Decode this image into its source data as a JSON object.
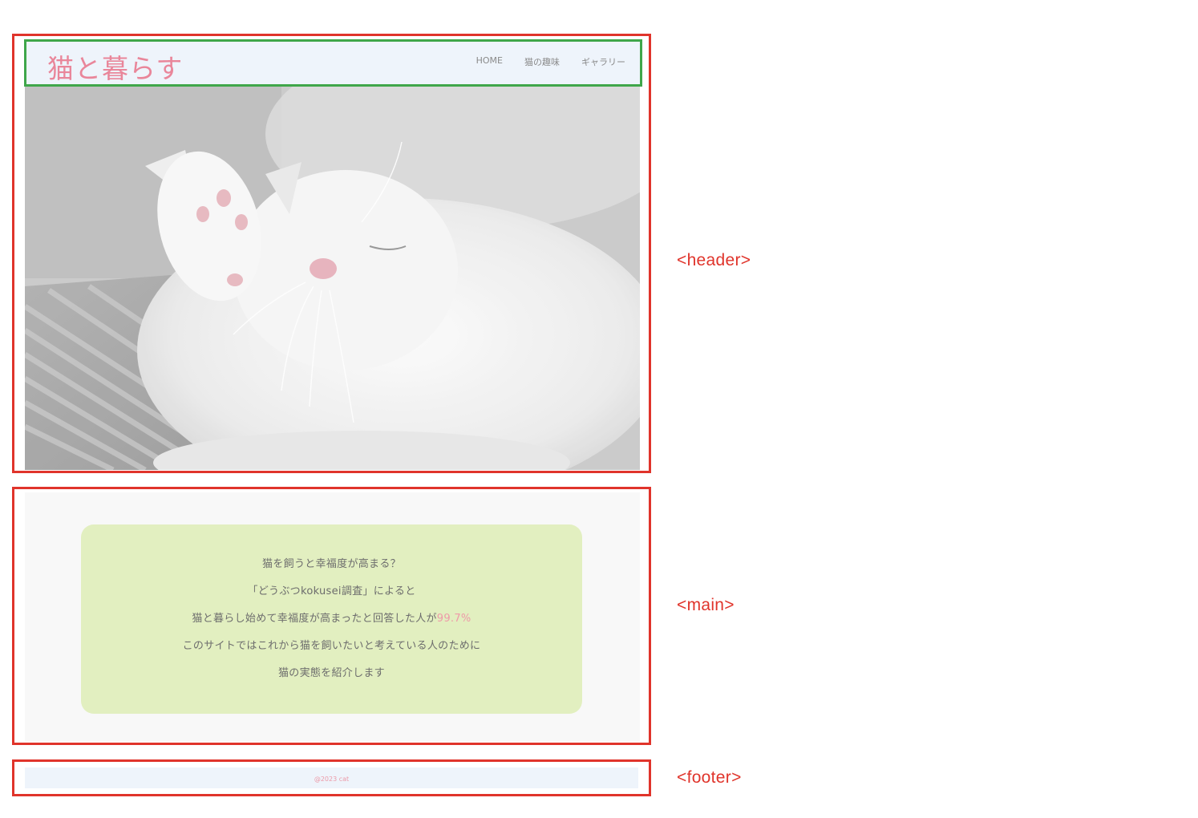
{
  "header": {
    "logo": "猫と暮らす",
    "nav": [
      "HOME",
      "猫の趣味",
      "ギャラリー"
    ]
  },
  "hero": {
    "image": "sleeping-white-kitten-photo"
  },
  "main": {
    "lines": [
      "猫を飼うと幸福度が高まる？",
      "「どうぶつkokusei調査」によると",
      "猫と暮らし始めて幸福度が高まったと回答した人が",
      "このサイトではこれから猫を飼いたいと考えている人のために",
      "猫の実態を紹介します"
    ],
    "highlight": "99.7%"
  },
  "footer": {
    "copyright": "@2023 cat"
  },
  "annotations": {
    "header": "<header>",
    "main": "<main>",
    "footer": "<footer>"
  },
  "colors": {
    "annotation": "#e0342b",
    "nav_annotation": "#3fa64a",
    "accent": "#e9869a",
    "card": "#e2efc0",
    "header_bg": "#eef4fb"
  }
}
